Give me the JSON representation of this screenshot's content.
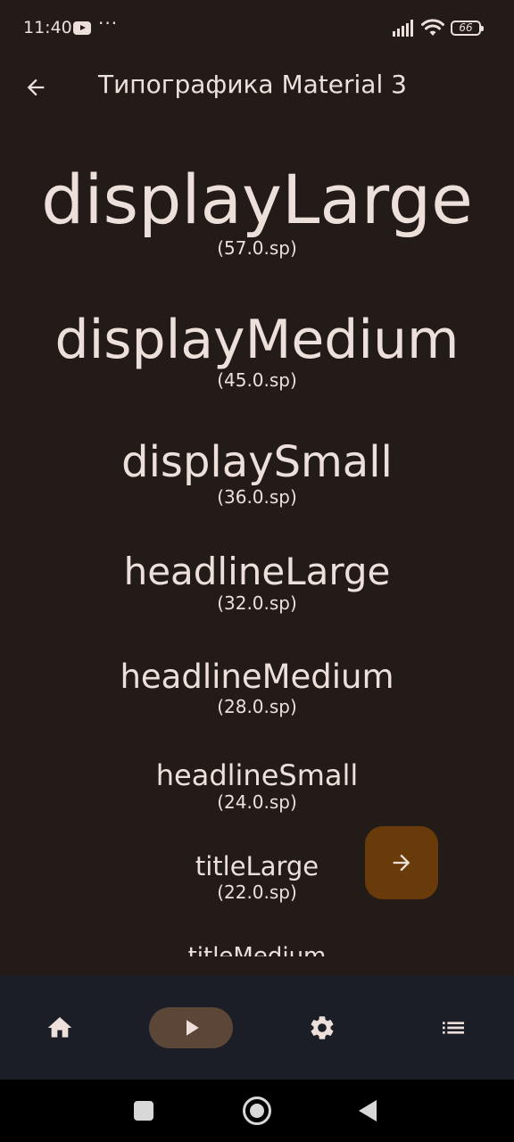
{
  "status_bar": {
    "time": "11:40",
    "battery": "66",
    "icons": [
      "youtube-notification-icon",
      "more-dots-icon",
      "signal-icon",
      "wifi-icon",
      "battery-icon"
    ]
  },
  "top_bar": {
    "title": "Типографика Material 3",
    "back_icon": "arrow-back-icon"
  },
  "typography": [
    {
      "name": "displayLarge",
      "size": "(57.0.sp)"
    },
    {
      "name": "displayMedium",
      "size": "(45.0.sp)"
    },
    {
      "name": "displaySmall",
      "size": "(36.0.sp)"
    },
    {
      "name": "headlineLarge",
      "size": "(32.0.sp)"
    },
    {
      "name": "headlineMedium",
      "size": "(28.0.sp)"
    },
    {
      "name": "headlineSmall",
      "size": "(24.0.sp)"
    },
    {
      "name": "titleLarge",
      "size": "(22.0.sp)"
    },
    {
      "name": "titleMedium",
      "size": ""
    }
  ],
  "fab": {
    "icon": "arrow-forward-icon",
    "color": "#6a3b0a"
  },
  "bottom_nav": {
    "items": [
      {
        "icon": "home-icon",
        "active": false
      },
      {
        "icon": "play-icon",
        "active": true
      },
      {
        "icon": "settings-gear-icon",
        "active": false
      },
      {
        "icon": "list-icon",
        "active": false
      }
    ],
    "active_indicator_color": "#5b4638"
  },
  "colors": {
    "background": "#221b18",
    "on_background": "#ede0da",
    "nav_background": "#1c1e27"
  }
}
